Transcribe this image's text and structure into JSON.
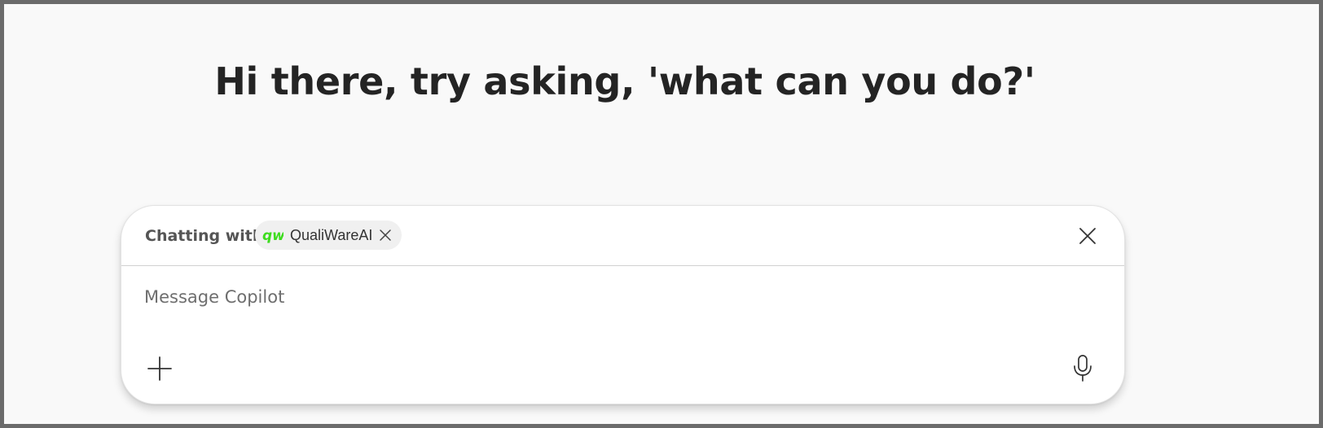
{
  "heading": "Hi there, try asking, 'what can you do?'",
  "composer": {
    "chatting_label": "Chatting with",
    "agent": {
      "logo_text": "qw",
      "name": "QualiWareAI",
      "logo_color": "#3ddc1e"
    },
    "message_placeholder": "Message Copilot",
    "icons": {
      "pill_close": "close-icon",
      "header_close": "close-icon",
      "add": "plus-icon",
      "mic": "microphone-icon"
    }
  }
}
